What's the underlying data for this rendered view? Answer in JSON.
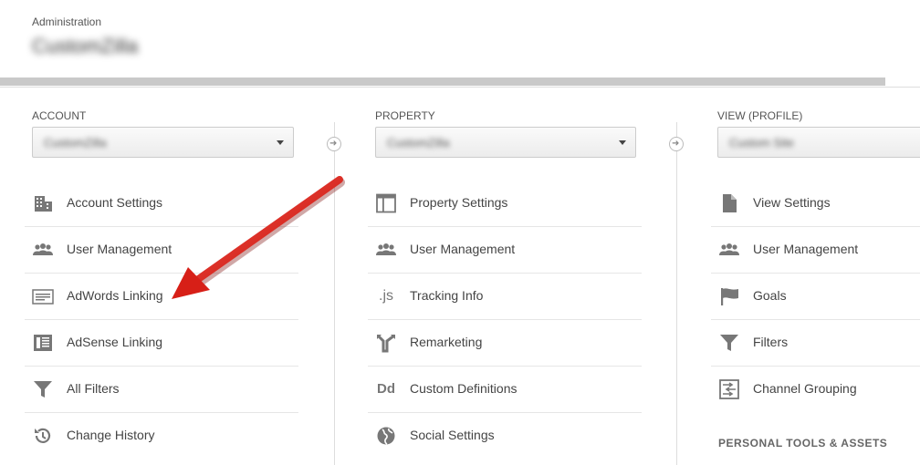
{
  "header": {
    "section_label": "Administration",
    "account_name": "CustomZilla",
    "progress_fraction": 0.962
  },
  "columns": {
    "account": {
      "label": "ACCOUNT",
      "selected": "CustomZilla",
      "items": [
        {
          "label": "Account Settings",
          "icon": "building-icon"
        },
        {
          "label": "User Management",
          "icon": "users-icon"
        },
        {
          "label": "AdWords Linking",
          "icon": "adwords-icon"
        },
        {
          "label": "AdSense Linking",
          "icon": "adsense-icon"
        },
        {
          "label": "All Filters",
          "icon": "filter-icon"
        },
        {
          "label": "Change History",
          "icon": "history-icon"
        }
      ]
    },
    "property": {
      "label": "PROPERTY",
      "selected": "CustomZilla",
      "items": [
        {
          "label": "Property Settings",
          "icon": "layout-icon"
        },
        {
          "label": "User Management",
          "icon": "users-icon"
        },
        {
          "label": "Tracking Info",
          "icon": "js-icon",
          "glyph": ".js"
        },
        {
          "label": "Remarketing",
          "icon": "remarketing-icon"
        },
        {
          "label": "Custom Definitions",
          "icon": "dd-icon",
          "glyph": "Dd"
        },
        {
          "label": "Social Settings",
          "icon": "globe-icon"
        }
      ]
    },
    "view": {
      "label": "VIEW (PROFILE)",
      "selected": "Custom Site",
      "items": [
        {
          "label": "View Settings",
          "icon": "document-icon"
        },
        {
          "label": "User Management",
          "icon": "users-icon"
        },
        {
          "label": "Goals",
          "icon": "flag-icon"
        },
        {
          "label": "Filters",
          "icon": "filter-icon"
        },
        {
          "label": "Channel Grouping",
          "icon": "channel-grouping-icon"
        }
      ],
      "section_title": "PERSONAL TOOLS & ASSETS"
    }
  },
  "annotation": {
    "color": "#e5241d"
  }
}
